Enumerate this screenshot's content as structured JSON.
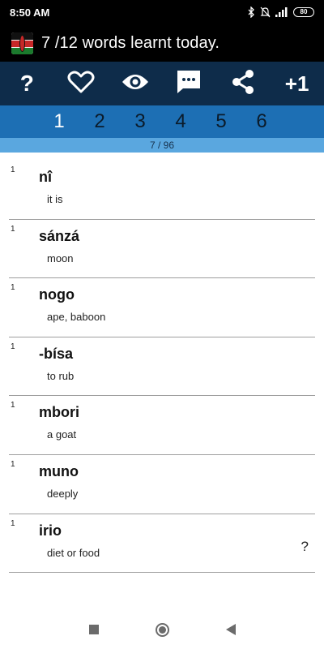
{
  "status_bar": {
    "time": "8:50 AM",
    "battery": "80",
    "icons": [
      "bluetooth-icon",
      "mute-icon",
      "signal-icon",
      "battery-icon"
    ]
  },
  "app_bar": {
    "icon": "kenya-flag-icon",
    "title": "7 /12 words learnt today."
  },
  "toolbar": {
    "help_label": "?",
    "like_icon": "heart-icon",
    "show_icon": "eye-icon",
    "comment_icon": "chat-icon",
    "share_icon": "share-icon",
    "plus_one_label": "+1"
  },
  "tabs": [
    "1",
    "2",
    "3",
    "4",
    "5",
    "6"
  ],
  "active_tab": "1",
  "progress": "7 / 96",
  "words": [
    {
      "rank": "1",
      "term": "nî",
      "meaning": "it is"
    },
    {
      "rank": "1",
      "term": "sánzá",
      "meaning": "moon"
    },
    {
      "rank": "1",
      "term": "nogo",
      "meaning": "ape, baboon"
    },
    {
      "rank": "1",
      "term": "-bísa",
      "meaning": "to rub"
    },
    {
      "rank": "1",
      "term": "mbori",
      "meaning": "a goat"
    },
    {
      "rank": "1",
      "term": "muno",
      "meaning": "deeply"
    },
    {
      "rank": "1",
      "term": "irio",
      "meaning": "diet or food",
      "question": "?"
    }
  ],
  "colors": {
    "toolbar": "#0e2c4a",
    "tabs": "#1d6fb4",
    "progress": "#5aa7df",
    "active_tab": "#ffffff"
  }
}
